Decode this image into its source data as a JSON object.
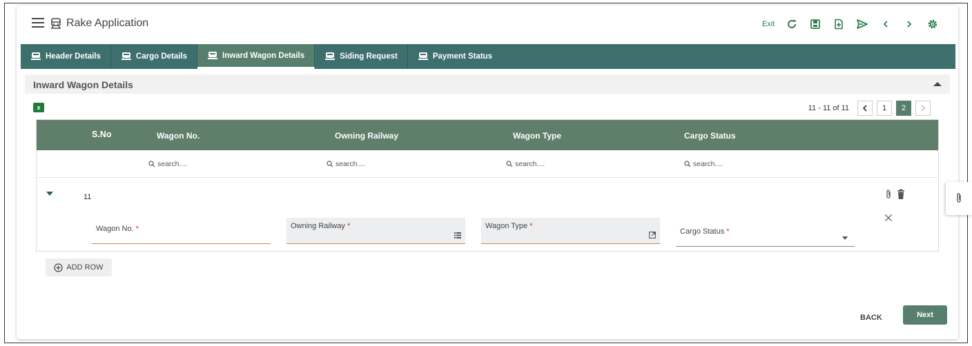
{
  "app": {
    "title": "Rake Application"
  },
  "toolbar": {
    "exit_label": "Exit"
  },
  "tabs": [
    {
      "label": "Header Details",
      "active": false
    },
    {
      "label": "Cargo Details",
      "active": false
    },
    {
      "label": "Inward Wagon Details",
      "active": true
    },
    {
      "label": "Siding Request",
      "active": false
    },
    {
      "label": "Payment Status",
      "active": false
    }
  ],
  "section": {
    "title": "Inward Wagon Details"
  },
  "pager": {
    "range_text": "11 - 11 of 11",
    "pages": [
      "1",
      "2"
    ],
    "current": "2"
  },
  "grid": {
    "columns": [
      "S.No",
      "Wagon No.",
      "Owning Railway",
      "Wagon Type",
      "Cargo Status"
    ],
    "filter_placeholder": "search....",
    "row": {
      "sno": "11",
      "fields": {
        "wagon_no": "Wagon No.",
        "owning_railway": "Owning Railway",
        "wagon_type": "Wagon Type",
        "cargo_status": "Cargo Status"
      },
      "required_marker": "*"
    }
  },
  "actions": {
    "add_row": "ADD ROW",
    "back": "BACK",
    "next": "Next"
  },
  "colors": {
    "tab_bar": "#3d6f6d",
    "active_tab": "#587f6e",
    "grid_header": "#5f7f6b",
    "icon_green": "#2e7d4f"
  }
}
